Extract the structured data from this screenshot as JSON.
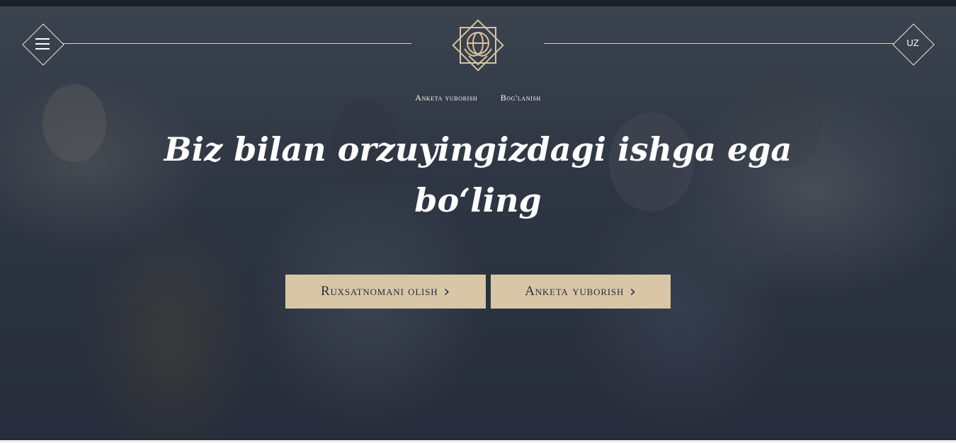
{
  "header": {
    "menu_icon": "hamburger-icon",
    "logo_icon": "globe-emblem-logo",
    "language": "UZ"
  },
  "nav": {
    "items": [
      {
        "label": "Anketa yuborish"
      },
      {
        "label": "Bog'lanish"
      }
    ]
  },
  "hero": {
    "headline": "Biz bilan orzuyingizdagi ishga ega bo‘ling",
    "buttons": [
      {
        "label": "Ruxsatnomani olish",
        "icon": "chevron-right-icon"
      },
      {
        "label": "Anketa yuborish",
        "icon": "chevron-right-icon"
      }
    ]
  },
  "colors": {
    "accent": "#d9c6a7",
    "button_text": "#262b45",
    "overlay": "#1c2130"
  }
}
